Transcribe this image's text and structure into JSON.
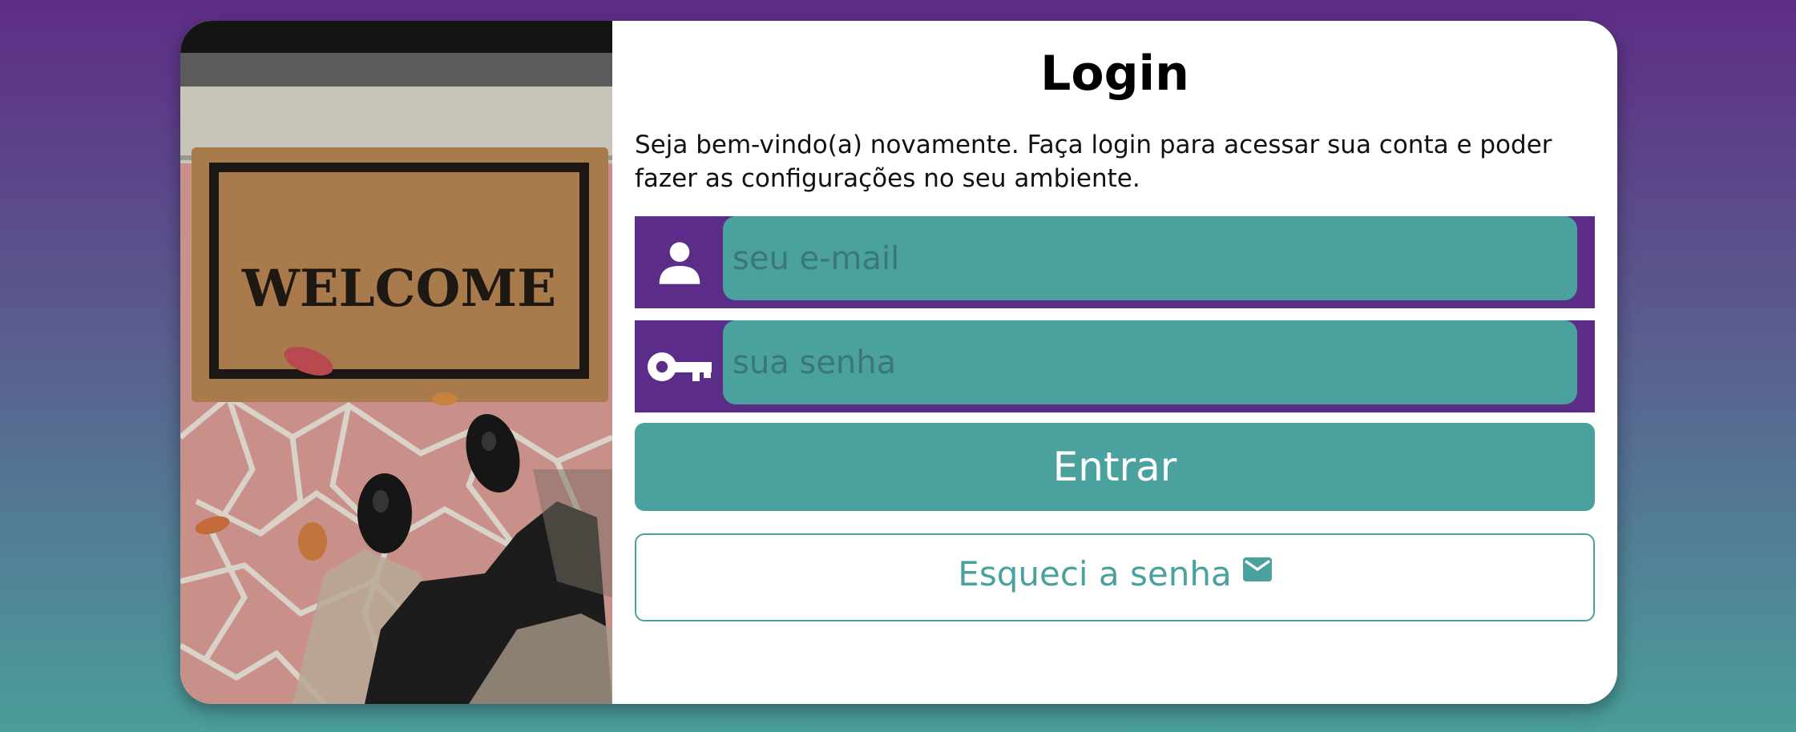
{
  "login": {
    "title": "Login",
    "intro": "Seja bem-vindo(a) novamente. Faça login para acessar sua conta e poder fazer as configurações no seu ambiente.",
    "email": {
      "placeholder": "seu e-mail",
      "value": "",
      "icon": "user-icon"
    },
    "password": {
      "placeholder": "sua senha",
      "value": "",
      "icon": "key-icon"
    },
    "submit_label": "Entrar",
    "forgot_label": "Esqueci a senha",
    "forgot_icon": "mail-icon"
  },
  "photo": {
    "mat_text": "WELCOME"
  },
  "colors": {
    "primary_purple": "#5b2d89",
    "accent_teal": "#4aa19e",
    "card_background": "#ffffff"
  }
}
